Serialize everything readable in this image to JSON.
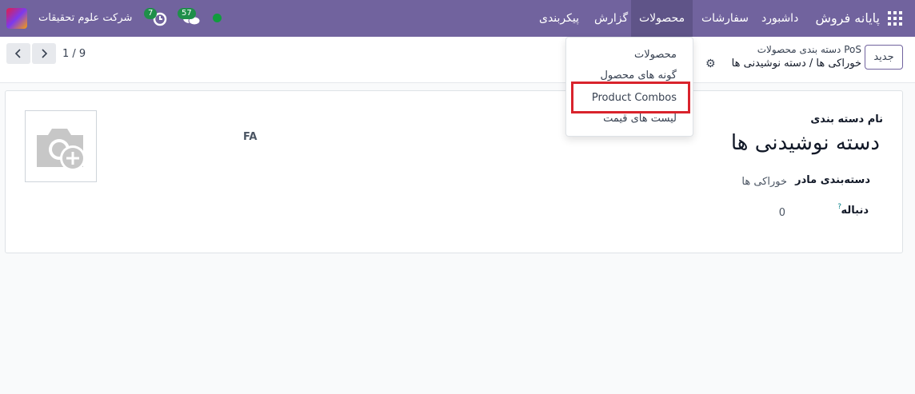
{
  "navbar": {
    "brand": "پایانه فروش",
    "menu": [
      "داشبورد",
      "سفارشات",
      "محصولات",
      "گزارش",
      "پیکربندی"
    ],
    "company": "شرکت علوم تحقیقات",
    "activity_count": "7",
    "messages_count": "57",
    "online_color": "#109c3e"
  },
  "control": {
    "new_label": "جدید",
    "breadcrumb_parent": "دسته بندی محصولات PoS",
    "breadcrumb_current": "خوراکی ها / دسته نوشیدنی ها",
    "pager": "1 / 9",
    "icons": [
      "gear-icon",
      "chevron-left-icon",
      "chevron-right-icon"
    ]
  },
  "form": {
    "name_label": "نام دسته بندی",
    "name_value": "دسته نوشیدنی ها",
    "parent_label": "دسته‌بندی مادر",
    "parent_value": "خوراکی ها",
    "sequence_label": "دنباله",
    "sequence_help": "?",
    "sequence_value": "0",
    "language": "FA"
  },
  "dropdown": {
    "items": [
      "محصولات",
      "گونه های محصول",
      "Product Combos",
      "لیست های قیمت"
    ],
    "highlighted": "Product Combos"
  },
  "colors": {
    "navbar": "#71639e",
    "highlight": "#d9232c"
  }
}
